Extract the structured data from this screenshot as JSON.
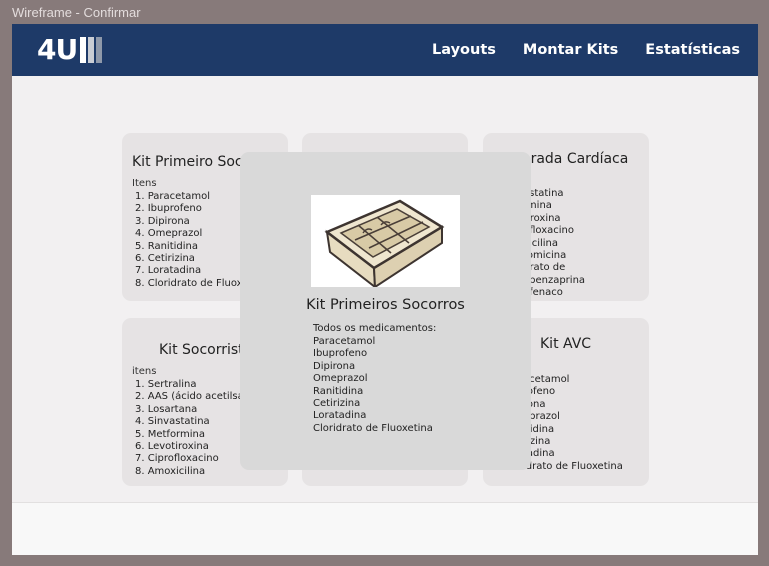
{
  "window": {
    "title": "Wireframe - Confirmar"
  },
  "navbar": {
    "logo_text": "4U",
    "logo_bar_colors": [
      "#ffffff",
      "#c9cdd4",
      "#8f99aa"
    ],
    "links": [
      "Layouts",
      "Montar Kits",
      "Estatísticas"
    ]
  },
  "colors": {
    "navbar": "#1e3a68",
    "page": "#f2f0f1",
    "card": "#e6e3e4",
    "modal": "#d9d9d9"
  },
  "cards": [
    {
      "title": "Kit Primeiro Soc",
      "subtitle": "Itens",
      "items": [
        "1. Paracetamol",
        "2. Ibuprofeno",
        "3. Dipirona",
        "4. Omeprazol",
        "5. Ranitidina",
        "6. Cetirizina",
        "7. Loratadina",
        "8. Cloridrato de Fluox"
      ]
    },
    {
      "title": "",
      "subtitle": "",
      "items": []
    },
    {
      "title": "arada Cardíaca",
      "subtitle": "",
      "items": [
        "astatina",
        "rmina",
        "tiroxina",
        "ofloxacino",
        "xicilina",
        "romicina",
        "drato de",
        "obenzaprina",
        "ofenaco"
      ]
    },
    {
      "title": "Kit Socorrist",
      "subtitle": "itens",
      "items": [
        "1. Sertralina",
        "2. AAS (ácido acetilsa",
        "3. Losartana",
        "4. Sinvastatina",
        "5. Metformina",
        "6. Levotiroxina",
        "7. Ciprofloxacino",
        "8. Amoxicilina"
      ]
    },
    {
      "title": "",
      "subtitle": "",
      "items": []
    },
    {
      "title": "Kit AVC",
      "subtitle": "",
      "items": [
        "acetamol",
        "rofeno",
        "rona",
        "eprazol",
        "itidina",
        "rizina",
        "tadina",
        "idrato de Fluoxetina"
      ]
    }
  ],
  "modal": {
    "image_icon": "organizer-box-image",
    "title": "Kit Primeiros Socorros",
    "label": "Todos os medicamentos:",
    "items": [
      "Paracetamol",
      "Ibuprofeno",
      "Dipirona",
      "Omeprazol",
      "Ranitidina",
      "Cetirizina",
      "Loratadina",
      "Cloridrato de Fluoxetina"
    ]
  }
}
